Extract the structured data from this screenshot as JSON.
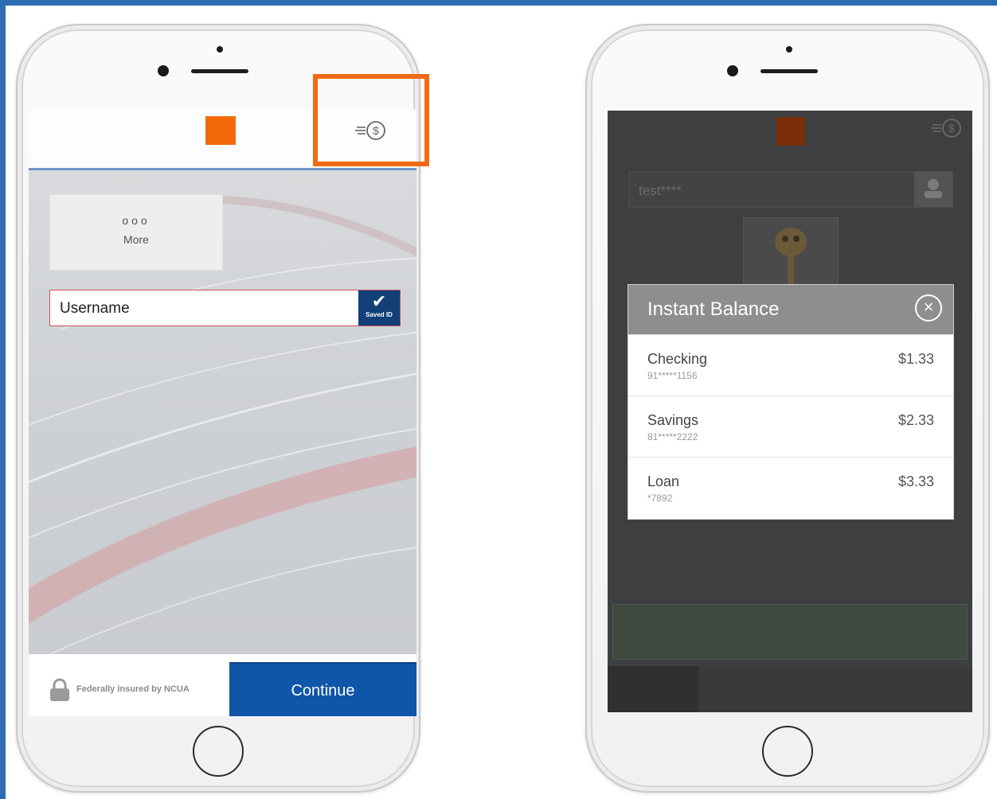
{
  "colors": {
    "frame": "#2e6db4",
    "highlight": "#f36a13",
    "continue_button": "#0f55a8",
    "logo": "#f26a0c"
  },
  "left_phone": {
    "header": {
      "logo_icon": "orange-square-logo",
      "instant_balance_icon": "instant-balance-icon"
    },
    "more_tile": {
      "dots": "ooo",
      "label": "More"
    },
    "username_field": {
      "value": "Username",
      "saved_id_label": "Saved ID"
    },
    "footer": {
      "ncua_text": "Federally insured by NCUA",
      "continue_label": "Continue"
    }
  },
  "right_phone": {
    "username_value": "test****",
    "instant_balance": {
      "title": "Instant Balance",
      "accounts": [
        {
          "name": "Checking",
          "number": "91*****1156",
          "balance": "$1.33"
        },
        {
          "name": "Savings",
          "number": "81*****2222",
          "balance": "$2.33"
        },
        {
          "name": "Loan",
          "number": "*7892",
          "balance": "$3.33"
        }
      ]
    }
  }
}
